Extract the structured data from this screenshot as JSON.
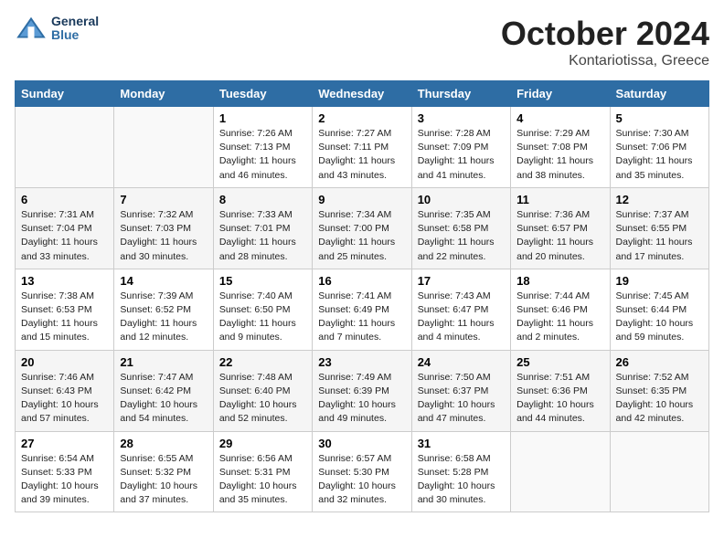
{
  "header": {
    "logo_line1": "General",
    "logo_line2": "Blue",
    "title": "October 2024",
    "subtitle": "Kontariotissa, Greece"
  },
  "days_of_week": [
    "Sunday",
    "Monday",
    "Tuesday",
    "Wednesday",
    "Thursday",
    "Friday",
    "Saturday"
  ],
  "weeks": [
    [
      {
        "day": "",
        "info": ""
      },
      {
        "day": "",
        "info": ""
      },
      {
        "day": "1",
        "info": "Sunrise: 7:26 AM\nSunset: 7:13 PM\nDaylight: 11 hours and 46 minutes."
      },
      {
        "day": "2",
        "info": "Sunrise: 7:27 AM\nSunset: 7:11 PM\nDaylight: 11 hours and 43 minutes."
      },
      {
        "day": "3",
        "info": "Sunrise: 7:28 AM\nSunset: 7:09 PM\nDaylight: 11 hours and 41 minutes."
      },
      {
        "day": "4",
        "info": "Sunrise: 7:29 AM\nSunset: 7:08 PM\nDaylight: 11 hours and 38 minutes."
      },
      {
        "day": "5",
        "info": "Sunrise: 7:30 AM\nSunset: 7:06 PM\nDaylight: 11 hours and 35 minutes."
      }
    ],
    [
      {
        "day": "6",
        "info": "Sunrise: 7:31 AM\nSunset: 7:04 PM\nDaylight: 11 hours and 33 minutes."
      },
      {
        "day": "7",
        "info": "Sunrise: 7:32 AM\nSunset: 7:03 PM\nDaylight: 11 hours and 30 minutes."
      },
      {
        "day": "8",
        "info": "Sunrise: 7:33 AM\nSunset: 7:01 PM\nDaylight: 11 hours and 28 minutes."
      },
      {
        "day": "9",
        "info": "Sunrise: 7:34 AM\nSunset: 7:00 PM\nDaylight: 11 hours and 25 minutes."
      },
      {
        "day": "10",
        "info": "Sunrise: 7:35 AM\nSunset: 6:58 PM\nDaylight: 11 hours and 22 minutes."
      },
      {
        "day": "11",
        "info": "Sunrise: 7:36 AM\nSunset: 6:57 PM\nDaylight: 11 hours and 20 minutes."
      },
      {
        "day": "12",
        "info": "Sunrise: 7:37 AM\nSunset: 6:55 PM\nDaylight: 11 hours and 17 minutes."
      }
    ],
    [
      {
        "day": "13",
        "info": "Sunrise: 7:38 AM\nSunset: 6:53 PM\nDaylight: 11 hours and 15 minutes."
      },
      {
        "day": "14",
        "info": "Sunrise: 7:39 AM\nSunset: 6:52 PM\nDaylight: 11 hours and 12 minutes."
      },
      {
        "day": "15",
        "info": "Sunrise: 7:40 AM\nSunset: 6:50 PM\nDaylight: 11 hours and 9 minutes."
      },
      {
        "day": "16",
        "info": "Sunrise: 7:41 AM\nSunset: 6:49 PM\nDaylight: 11 hours and 7 minutes."
      },
      {
        "day": "17",
        "info": "Sunrise: 7:43 AM\nSunset: 6:47 PM\nDaylight: 11 hours and 4 minutes."
      },
      {
        "day": "18",
        "info": "Sunrise: 7:44 AM\nSunset: 6:46 PM\nDaylight: 11 hours and 2 minutes."
      },
      {
        "day": "19",
        "info": "Sunrise: 7:45 AM\nSunset: 6:44 PM\nDaylight: 10 hours and 59 minutes."
      }
    ],
    [
      {
        "day": "20",
        "info": "Sunrise: 7:46 AM\nSunset: 6:43 PM\nDaylight: 10 hours and 57 minutes."
      },
      {
        "day": "21",
        "info": "Sunrise: 7:47 AM\nSunset: 6:42 PM\nDaylight: 10 hours and 54 minutes."
      },
      {
        "day": "22",
        "info": "Sunrise: 7:48 AM\nSunset: 6:40 PM\nDaylight: 10 hours and 52 minutes."
      },
      {
        "day": "23",
        "info": "Sunrise: 7:49 AM\nSunset: 6:39 PM\nDaylight: 10 hours and 49 minutes."
      },
      {
        "day": "24",
        "info": "Sunrise: 7:50 AM\nSunset: 6:37 PM\nDaylight: 10 hours and 47 minutes."
      },
      {
        "day": "25",
        "info": "Sunrise: 7:51 AM\nSunset: 6:36 PM\nDaylight: 10 hours and 44 minutes."
      },
      {
        "day": "26",
        "info": "Sunrise: 7:52 AM\nSunset: 6:35 PM\nDaylight: 10 hours and 42 minutes."
      }
    ],
    [
      {
        "day": "27",
        "info": "Sunrise: 6:54 AM\nSunset: 5:33 PM\nDaylight: 10 hours and 39 minutes."
      },
      {
        "day": "28",
        "info": "Sunrise: 6:55 AM\nSunset: 5:32 PM\nDaylight: 10 hours and 37 minutes."
      },
      {
        "day": "29",
        "info": "Sunrise: 6:56 AM\nSunset: 5:31 PM\nDaylight: 10 hours and 35 minutes."
      },
      {
        "day": "30",
        "info": "Sunrise: 6:57 AM\nSunset: 5:30 PM\nDaylight: 10 hours and 32 minutes."
      },
      {
        "day": "31",
        "info": "Sunrise: 6:58 AM\nSunset: 5:28 PM\nDaylight: 10 hours and 30 minutes."
      },
      {
        "day": "",
        "info": ""
      },
      {
        "day": "",
        "info": ""
      }
    ]
  ]
}
